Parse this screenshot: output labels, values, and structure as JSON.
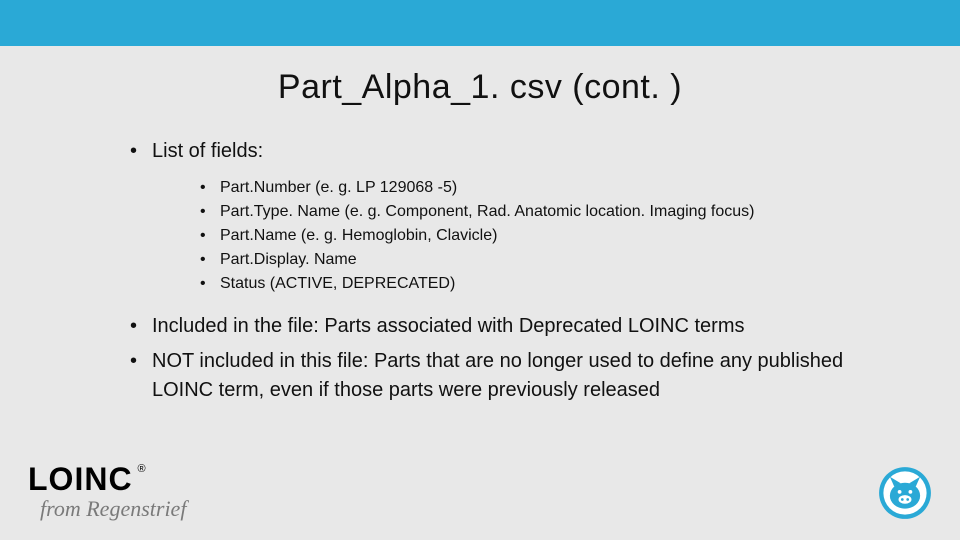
{
  "title": "Part_Alpha_1. csv (cont. )",
  "bullets": {
    "intro": "List of fields:",
    "fields": [
      "Part.Number (e. g. LP 129068 -5)",
      "Part.Type. Name (e. g. Component, Rad. Anatomic location. Imaging focus)",
      "Part.Name (e. g. Hemoglobin, Clavicle)",
      "Part.Display. Name",
      "Status (ACTIVE, DEPRECATED)"
    ],
    "included": "Included in the file: Parts associated with Deprecated LOINC terms",
    "not_included": "NOT included in this file: Parts that are no longer used to define any published LOINC term, even if those parts were previously released"
  },
  "footer": {
    "logo_text": "LOINC",
    "registered": "®",
    "tagline": "from Regenstrief"
  },
  "colors": {
    "accent": "#2aa9d6",
    "bg": "#e8e8e8"
  }
}
